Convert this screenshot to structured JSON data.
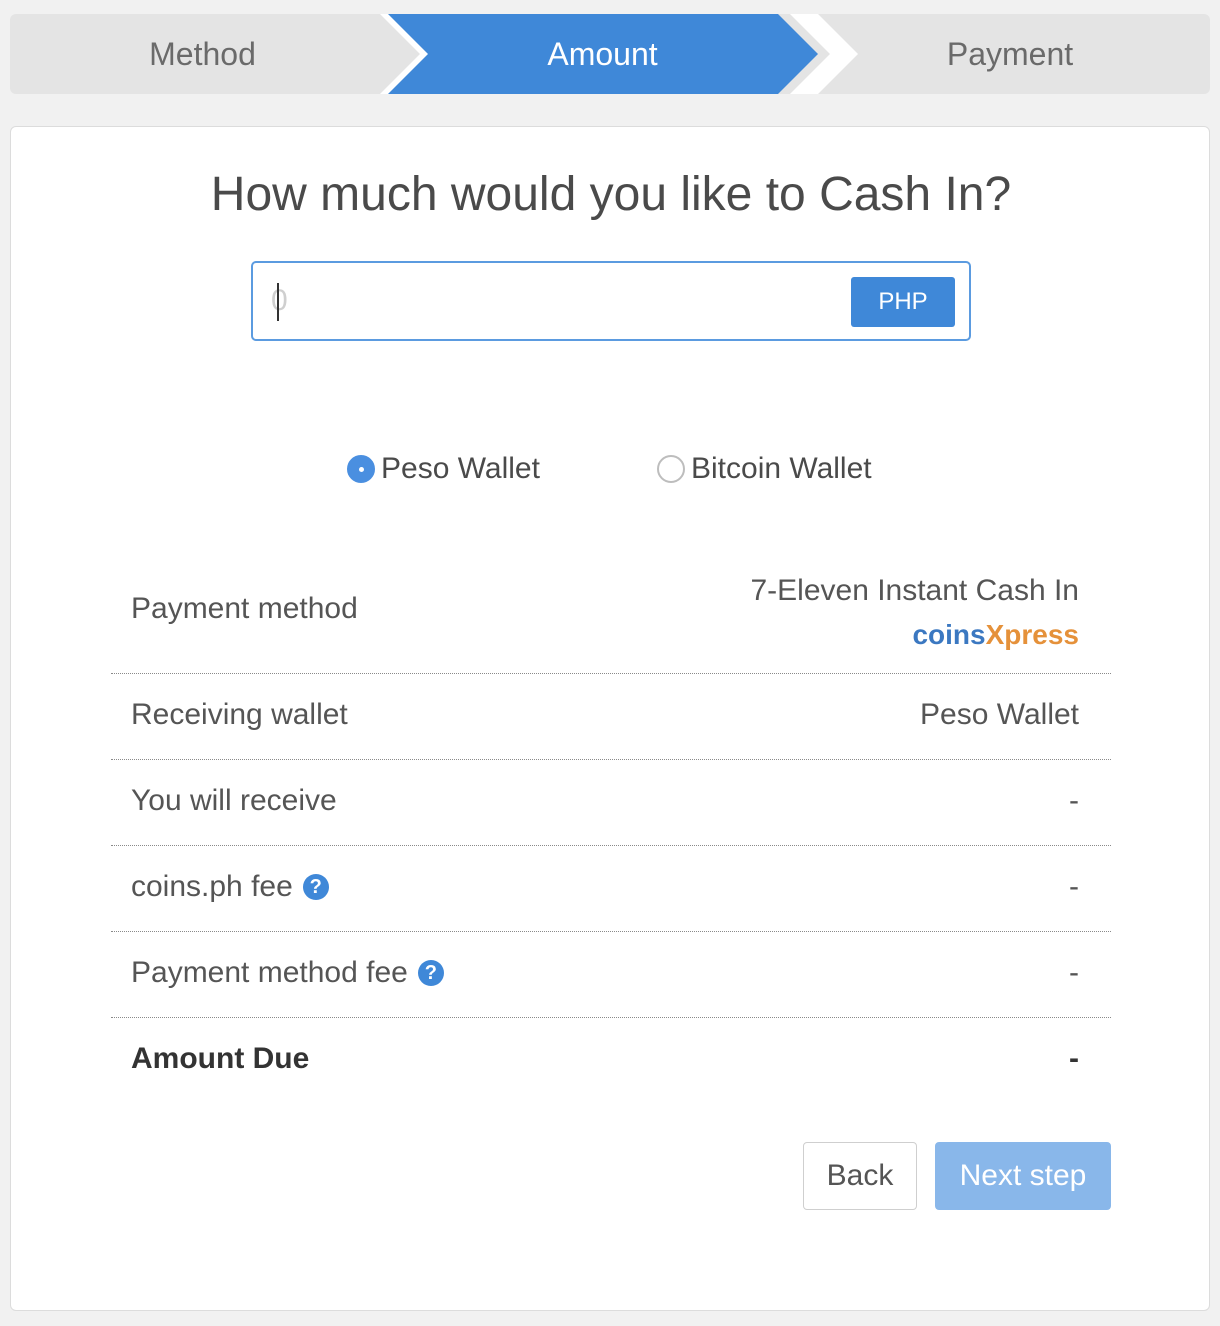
{
  "stepper": {
    "steps": [
      {
        "label": "Method",
        "active": false
      },
      {
        "label": "Amount",
        "active": true
      },
      {
        "label": "Payment",
        "active": false
      }
    ]
  },
  "main": {
    "title": "How much would you like to Cash In?",
    "amount_input": {
      "value": "",
      "placeholder": "0"
    },
    "currency_label": "PHP",
    "wallet_options": [
      {
        "label": "Peso Wallet",
        "selected": true
      },
      {
        "label": "Bitcoin Wallet",
        "selected": false
      }
    ]
  },
  "summary": {
    "payment_method": {
      "label": "Payment method",
      "value": "7-Eleven Instant Cash In",
      "brand_part1": "coins",
      "brand_part2": "Xpress"
    },
    "receiving_wallet": {
      "label": "Receiving wallet",
      "value": "Peso Wallet"
    },
    "you_will_receive": {
      "label": "You will receive",
      "value": "-"
    },
    "coins_fee": {
      "label": "coins.ph fee",
      "value": "-",
      "help_icon": "question-circle-icon"
    },
    "payment_method_fee": {
      "label": "Payment method fee",
      "value": "-",
      "help_icon": "question-circle-icon"
    },
    "amount_due": {
      "label": "Amount Due",
      "value": "-"
    }
  },
  "actions": {
    "back_label": "Back",
    "next_label": "Next step"
  },
  "colors": {
    "accent": "#3f88d8",
    "next_disabled": "#89b7ea",
    "brand_coins": "#3b78c1",
    "brand_xpress": "#e5913a"
  }
}
